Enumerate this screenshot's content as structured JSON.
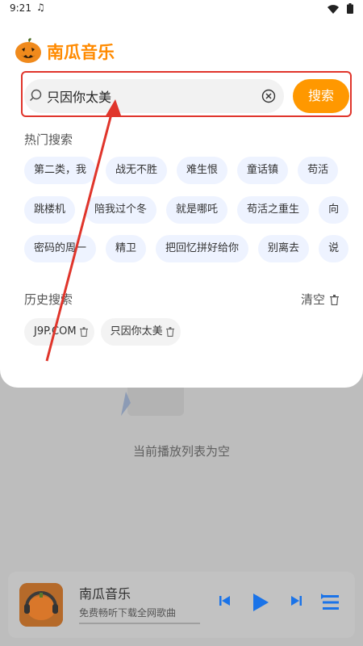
{
  "status_bar": {
    "time": "9:21"
  },
  "background": {
    "empty_text": "当前播放列表为空",
    "player": {
      "title": "南瓜音乐",
      "subtitle": "免费畅听下载全网歌曲"
    }
  },
  "header": {
    "app_name": "南瓜音乐"
  },
  "search": {
    "value": "只因你太美",
    "button_label": "搜索"
  },
  "hot_search": {
    "title": "热门搜索",
    "rows": [
      [
        "第二类，我",
        "战无不胜",
        "难生恨",
        "童话镇",
        "苟活"
      ],
      [
        "跳楼机",
        "陪我过个冬",
        "就是哪吒",
        "苟活之重生",
        "向"
      ],
      [
        "密码的周一",
        "精卫",
        "把回忆拼好给你",
        "别离去",
        "说"
      ]
    ]
  },
  "history": {
    "title": "历史搜索",
    "clear_label": "清空",
    "items": [
      "J9P.COM",
      "只因你太美"
    ]
  },
  "colors": {
    "accent": "#ff9800",
    "brand_text": "#ff8a00",
    "chip_bg": "#eef3ff",
    "highlight": "#e0352b"
  }
}
